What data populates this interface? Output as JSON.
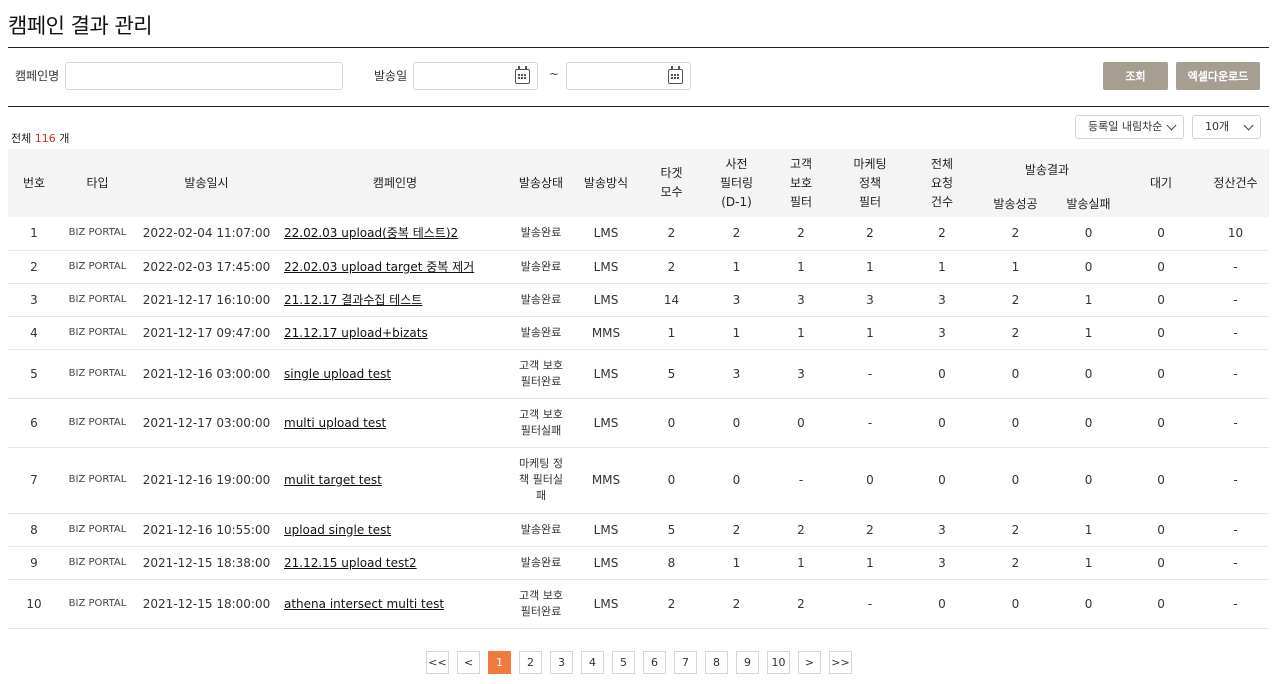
{
  "page": {
    "title": "캠페인 결과 관리"
  },
  "search": {
    "campaign_label": "캠페인명",
    "campaign_value": "",
    "send_date_label": "발송일",
    "date_from": "",
    "date_to": "",
    "range_separator": "~",
    "query_button": "조회",
    "excel_button": "엑셀다운로드"
  },
  "summary": {
    "total_prefix": "전체",
    "total_count": "116",
    "total_suffix": "개"
  },
  "controls": {
    "sort_selected": "등록일 내림차순",
    "page_size_selected": "10개"
  },
  "table": {
    "headers": {
      "no": "번호",
      "type": "타입",
      "send_datetime": "발송일시",
      "campaign_name": "캠페인명",
      "send_status": "발송상태",
      "send_method": "발송방식",
      "target_count_1": "타겟",
      "target_count_2": "모수",
      "pre_filter_1": "사전",
      "pre_filter_2": "필터링",
      "pre_filter_3": "(D-1)",
      "cust_filter_1": "고객",
      "cust_filter_2": "보호",
      "cust_filter_3": "필터",
      "mkt_filter_1": "마케팅",
      "mkt_filter_2": "정책",
      "mkt_filter_3": "필터",
      "total_req_1": "전체",
      "total_req_2": "요청",
      "total_req_3": "건수",
      "send_result": "발송결과",
      "send_success": "발송성공",
      "send_fail": "발송실패",
      "waiting": "대기",
      "billing_count": "정산건수"
    },
    "rows": [
      {
        "no": "1",
        "type": "BIZ PORTAL",
        "datetime": "2022-02-04 11:07:00",
        "name": "22.02.03 upload(중복 테스트)2",
        "status": [
          "발송완료"
        ],
        "method": "LMS",
        "target": "2",
        "pre": "2",
        "cust": "2",
        "mkt": "2",
        "total": "2",
        "success": "2",
        "fail": "0",
        "wait": "0",
        "billing": "10"
      },
      {
        "no": "2",
        "type": "BIZ PORTAL",
        "datetime": "2022-02-03 17:45:00",
        "name": "22.02.03 upload target 중복 제거",
        "status": [
          "발송완료"
        ],
        "method": "LMS",
        "target": "2",
        "pre": "1",
        "cust": "1",
        "mkt": "1",
        "total": "1",
        "success": "1",
        "fail": "0",
        "wait": "0",
        "billing": "-"
      },
      {
        "no": "3",
        "type": "BIZ PORTAL",
        "datetime": "2021-12-17 16:10:00",
        "name": "21.12.17 결과수집 테스트",
        "status": [
          "발송완료"
        ],
        "method": "LMS",
        "target": "14",
        "pre": "3",
        "cust": "3",
        "mkt": "3",
        "total": "3",
        "success": "2",
        "fail": "1",
        "wait": "0",
        "billing": "-"
      },
      {
        "no": "4",
        "type": "BIZ PORTAL",
        "datetime": "2021-12-17 09:47:00",
        "name": "21.12.17 upload+bizats",
        "status": [
          "발송완료"
        ],
        "method": "MMS",
        "target": "1",
        "pre": "1",
        "cust": "1",
        "mkt": "1",
        "total": "3",
        "success": "2",
        "fail": "1",
        "wait": "0",
        "billing": "-"
      },
      {
        "no": "5",
        "type": "BIZ PORTAL",
        "datetime": "2021-12-16 03:00:00",
        "name": "single upload test",
        "status": [
          "고객 보호",
          "필터완료"
        ],
        "method": "LMS",
        "target": "5",
        "pre": "3",
        "cust": "3",
        "mkt": "-",
        "total": "0",
        "success": "0",
        "fail": "0",
        "wait": "0",
        "billing": "-"
      },
      {
        "no": "6",
        "type": "BIZ PORTAL",
        "datetime": "2021-12-17 03:00:00",
        "name": "multi upload test",
        "status": [
          "고객 보호",
          "필터실패"
        ],
        "method": "LMS",
        "target": "0",
        "pre": "0",
        "cust": "0",
        "mkt": "-",
        "total": "0",
        "success": "0",
        "fail": "0",
        "wait": "0",
        "billing": "-"
      },
      {
        "no": "7",
        "type": "BIZ PORTAL",
        "datetime": "2021-12-16 19:00:00",
        "name": "mulit target test",
        "status": [
          "마케팅 정",
          "책 필터실",
          "패"
        ],
        "method": "MMS",
        "target": "0",
        "pre": "0",
        "cust": "-",
        "mkt": "0",
        "total": "0",
        "success": "0",
        "fail": "0",
        "wait": "0",
        "billing": "-"
      },
      {
        "no": "8",
        "type": "BIZ PORTAL",
        "datetime": "2021-12-16 10:55:00",
        "name": "upload single test",
        "status": [
          "발송완료"
        ],
        "method": "LMS",
        "target": "5",
        "pre": "2",
        "cust": "2",
        "mkt": "2",
        "total": "3",
        "success": "2",
        "fail": "1",
        "wait": "0",
        "billing": "-"
      },
      {
        "no": "9",
        "type": "BIZ PORTAL",
        "datetime": "2021-12-15 18:38:00",
        "name": "21.12.15 upload test2",
        "status": [
          "발송완료"
        ],
        "method": "LMS",
        "target": "8",
        "pre": "1",
        "cust": "1",
        "mkt": "1",
        "total": "3",
        "success": "2",
        "fail": "1",
        "wait": "0",
        "billing": "-"
      },
      {
        "no": "10",
        "type": "BIZ PORTAL",
        "datetime": "2021-12-15 18:00:00",
        "name": "athena intersect multi test",
        "status": [
          "고객 보호",
          "필터완료"
        ],
        "method": "LMS",
        "target": "2",
        "pre": "2",
        "cust": "2",
        "mkt": "-",
        "total": "0",
        "success": "0",
        "fail": "0",
        "wait": "0",
        "billing": "-"
      }
    ]
  },
  "pagination": {
    "first": "<<",
    "prev": "<",
    "next": ">",
    "last": ">>",
    "pages": [
      "1",
      "2",
      "3",
      "4",
      "5",
      "6",
      "7",
      "8",
      "9",
      "10"
    ],
    "current": "1"
  },
  "colors": {
    "button_bg": "#a59e91",
    "active_page": "#f07b3f",
    "total_count": "#d32f2f"
  }
}
